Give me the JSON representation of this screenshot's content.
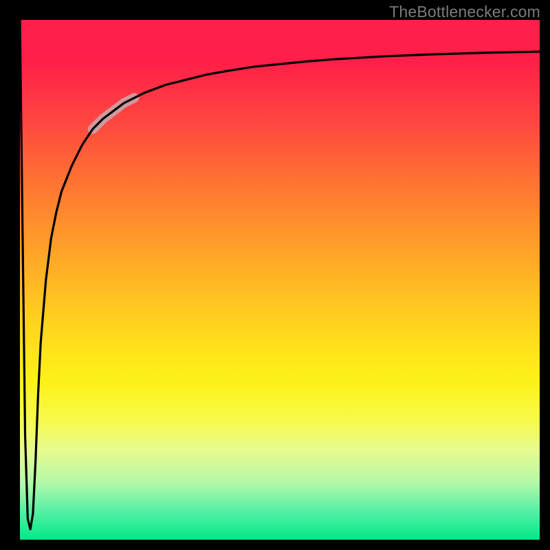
{
  "watermark": "TheBottleneсker.com",
  "chart_data": {
    "type": "line",
    "title": "",
    "xlabel": "",
    "ylabel": "",
    "xlim": [
      0,
      100
    ],
    "ylim": [
      0,
      100
    ],
    "background_gradient": {
      "orientation": "vertical",
      "stops": [
        {
          "pos": 0.0,
          "color": "#ff1f48"
        },
        {
          "pos": 0.5,
          "color": "#ffd520"
        },
        {
          "pos": 0.75,
          "color": "#fcf316"
        },
        {
          "pos": 1.0,
          "color": "#00e98a"
        }
      ]
    },
    "series": [
      {
        "name": "bottleneck-curve",
        "color": "#000000",
        "width": 3,
        "x": [
          0.0,
          0.5,
          1.0,
          1.5,
          2.0,
          2.5,
          3.0,
          3.5,
          4.0,
          5.0,
          6.0,
          7.0,
          8.0,
          10.0,
          12.0,
          14.0,
          16.0,
          18.0,
          20.0,
          24.0,
          28.0,
          32.0,
          36.0,
          40.0,
          45.0,
          50.0,
          55.0,
          60.0,
          70.0,
          80.0,
          90.0,
          100.0
        ],
        "values": [
          100.0,
          60.0,
          20.0,
          4.0,
          2.0,
          5.0,
          15.0,
          28.0,
          38.0,
          50.0,
          58.0,
          63.0,
          67.0,
          72.0,
          76.0,
          79.0,
          81.0,
          82.5,
          84.0,
          86.0,
          87.5,
          88.5,
          89.5,
          90.2,
          91.0,
          91.5,
          92.0,
          92.4,
          93.0,
          93.4,
          93.7,
          93.9
        ]
      },
      {
        "name": "highlight-segment",
        "color": "#caa3a8",
        "width": 14,
        "opacity": 0.9,
        "x": [
          14.0,
          16.0,
          18.0,
          20.0,
          22.0
        ],
        "values": [
          79.0,
          81.0,
          82.5,
          84.0,
          85.0
        ]
      }
    ],
    "annotations": []
  }
}
